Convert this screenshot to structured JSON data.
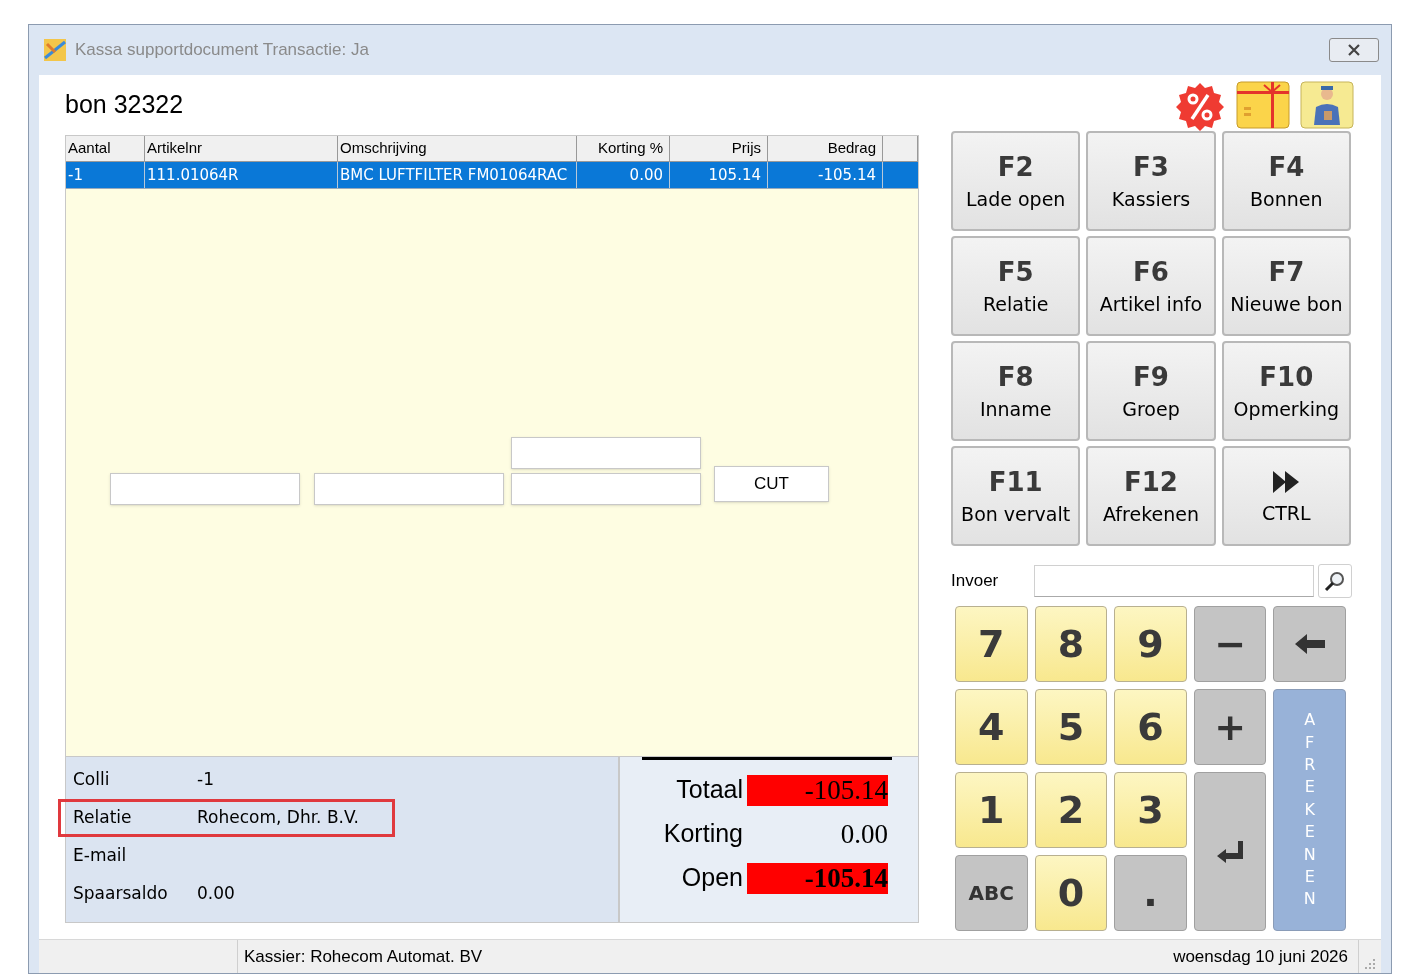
{
  "window": {
    "title": "Kassa supportdocument Transactie: Ja"
  },
  "receipt_title": "bon 32322",
  "table": {
    "columns": [
      {
        "label": "Aantal"
      },
      {
        "label": "Artikelnr"
      },
      {
        "label": "Omschrijving"
      },
      {
        "label": "Korting %"
      },
      {
        "label": "Prijs"
      },
      {
        "label": "Bedrag"
      }
    ],
    "rows": [
      {
        "selected": true,
        "cells": [
          "-1",
          "111.01064R",
          "BMC LUFTFILTER FM01064RAC",
          "0.00",
          "105.14",
          "-105.14"
        ]
      }
    ]
  },
  "cut_button": {
    "label": "CUT"
  },
  "info": [
    {
      "label": "Colli",
      "value": "-1",
      "highlighted": false
    },
    {
      "label": "Relatie",
      "value": "Rohecom, Dhr. B.V.",
      "highlighted": true
    },
    {
      "label": "E-mail",
      "highlighted": false
    },
    {
      "label": "Spaarsaldo",
      "value": "0.00",
      "highlighted": false
    }
  ],
  "totals": [
    {
      "label": "Totaal",
      "value": "-105.14",
      "alert": true,
      "bold": false
    },
    {
      "label": "Korting",
      "value": "0.00",
      "alert": false,
      "bold": false
    },
    {
      "label": "Open",
      "value": "-105.14",
      "alert": true,
      "bold": true
    }
  ],
  "function_keys": [
    {
      "kind": "fkey",
      "key": "F2",
      "label": "Lade open"
    },
    {
      "kind": "fkey",
      "key": "F3",
      "label": "Kassiers"
    },
    {
      "kind": "fkey",
      "key": "F4",
      "label": "Bonnen"
    },
    {
      "kind": "fkey",
      "key": "F5",
      "label": "Relatie"
    },
    {
      "kind": "fkey",
      "key": "F6",
      "label": "Artikel info"
    },
    {
      "kind": "fkey",
      "key": "F7",
      "label": "Nieuwe bon"
    },
    {
      "kind": "fkey",
      "key": "F8",
      "label": "Inname"
    },
    {
      "kind": "fkey",
      "key": "F9",
      "label": "Groep"
    },
    {
      "kind": "fkey",
      "key": "F10",
      "label": "Opmerking"
    },
    {
      "kind": "fkey",
      "key": "F11",
      "label": "Bon vervalt"
    },
    {
      "kind": "fkey",
      "key": "F12",
      "label": "Afrekenen"
    },
    {
      "kind": "forward",
      "label": "CTRL"
    }
  ],
  "input": {
    "label": "Invoer"
  },
  "keypad": [
    {
      "kind": "digit",
      "label": "7"
    },
    {
      "kind": "digit",
      "label": "8"
    },
    {
      "kind": "digit",
      "label": "9"
    },
    {
      "kind": "op",
      "label": "−"
    },
    {
      "kind": "backspace"
    },
    {
      "kind": "digit",
      "label": "4"
    },
    {
      "kind": "digit",
      "label": "5"
    },
    {
      "kind": "digit",
      "label": "6"
    },
    {
      "kind": "op",
      "label": "+"
    },
    {
      "kind": "digit",
      "label": "1"
    },
    {
      "kind": "digit",
      "label": "2"
    },
    {
      "kind": "digit",
      "label": "3"
    },
    {
      "kind": "enter"
    },
    {
      "kind": "small",
      "label": "ABC"
    },
    {
      "kind": "digit",
      "label": "0"
    },
    {
      "kind": "op",
      "label": "."
    },
    {
      "kind": "pay",
      "label": "AFREKENEN"
    }
  ],
  "status_bar": {
    "cashier": "Kassier: Rohecom Automat. BV",
    "date": "woensdag 10 juni 2026"
  }
}
